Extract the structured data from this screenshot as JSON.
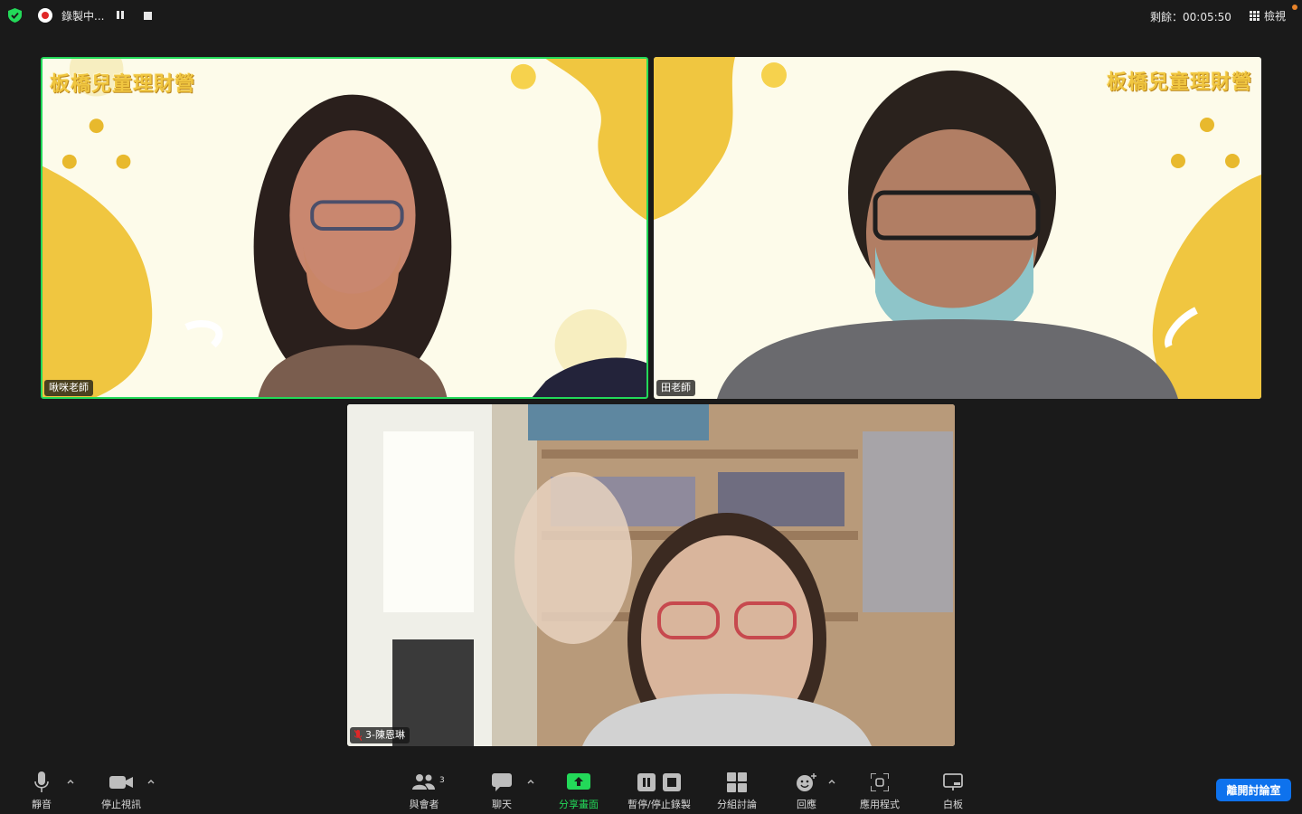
{
  "top_bar": {
    "recording_status": "錄製中...",
    "remaining_time": "剩餘：00:05:50",
    "view_label": "檢視",
    "icons": [
      "shield-check-icon",
      "record-icon",
      "pause-icon",
      "stop-icon",
      "grid-icon"
    ],
    "colors": {
      "shield": "#23d959",
      "record": "#e02828",
      "alert_dot": "#e8832a"
    }
  },
  "participants": [
    {
      "name": "啾咪老師",
      "background_banner": "板橋兒童理財營",
      "active_speaker": true
    },
    {
      "name": "田老師",
      "background_banner": "板橋兒童理財營",
      "active_speaker": false
    },
    {
      "name": "3-陳恩琳",
      "muted": true,
      "active_speaker": false
    }
  ],
  "toolbar": {
    "mute": "靜音",
    "stop_video": "停止視訊",
    "participants": "與會者",
    "participants_count": "3",
    "chat": "聊天",
    "share_screen": "分享畫面",
    "pause_stop_recording": "暫停/停止錄製",
    "breakout_rooms": "分組討論",
    "reactions": "回應",
    "apps": "應用程式",
    "whiteboard": "白板",
    "leave_room": "離開討論室"
  },
  "colors": {
    "active_speaker_border": "#23d959",
    "share_green": "#23d959",
    "leave_button": "#0e72ed",
    "background": "#1a1a1a"
  }
}
